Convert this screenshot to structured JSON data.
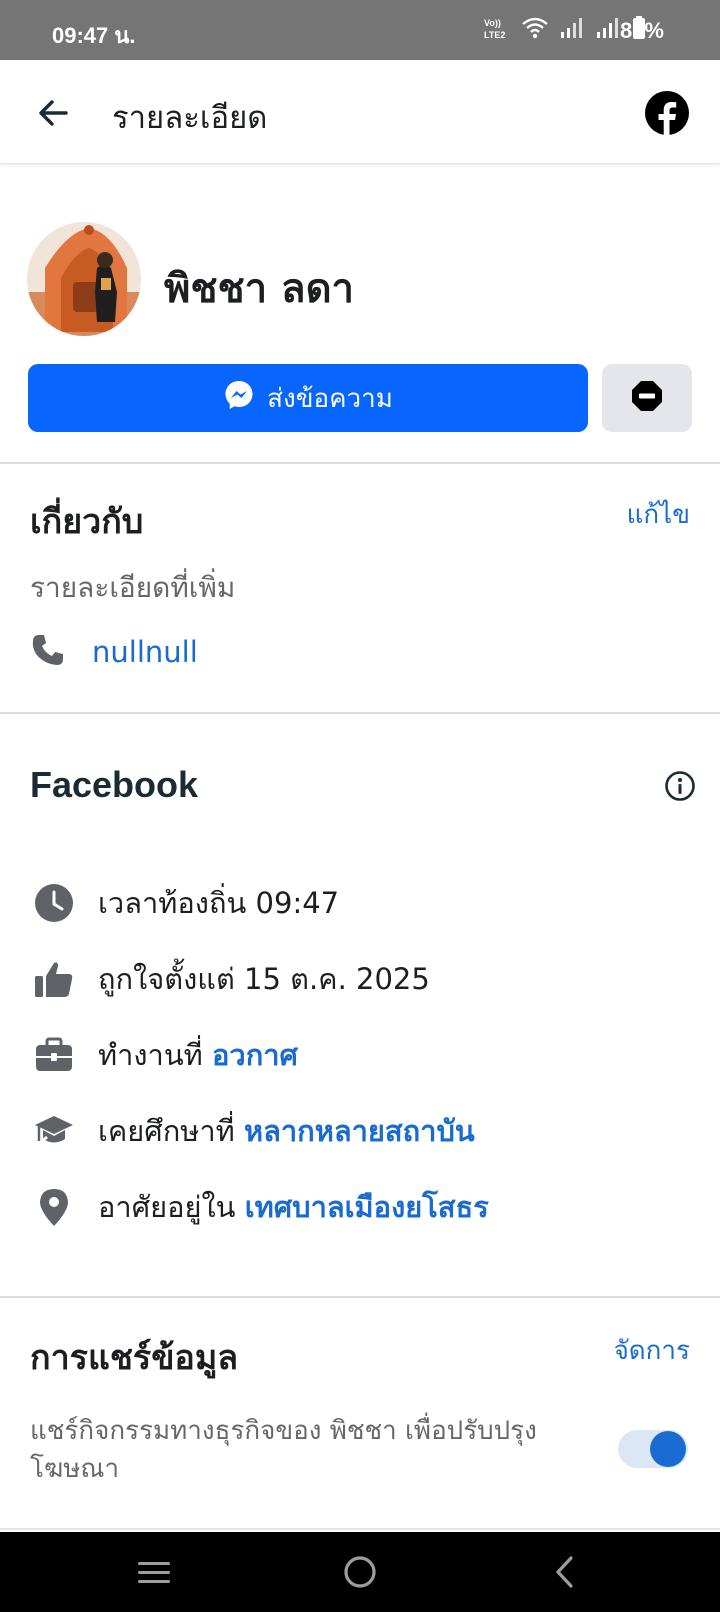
{
  "status_bar": {
    "time": "09:47 น.",
    "network_label": "Vo)) LTE2",
    "battery": "85%"
  },
  "app_bar": {
    "title": "รายละเอียด",
    "back_icon": "arrow-left-icon",
    "brand_icon": "facebook-logo-icon"
  },
  "profile": {
    "name": "พิชชา ลดา",
    "message_button": "ส่งข้อความ",
    "block_icon": "block-icon"
  },
  "about": {
    "title": "เกี่ยวกับ",
    "edit_link": "แก้ไข",
    "subtitle": "รายละเอียดที่เพิ่ม",
    "phone": "nullnull"
  },
  "facebook_section": {
    "title": "Facebook",
    "rows": [
      {
        "icon": "clock-icon",
        "label": "เวลาท้องถิ่น 09:47",
        "link": ""
      },
      {
        "icon": "thumbs-up-icon",
        "label": "ถูกใจตั้งแต่ 15 ต.ค. 2025",
        "link": ""
      },
      {
        "icon": "briefcase-icon",
        "label": "ทำงานที่ ",
        "link": "อวกาศ"
      },
      {
        "icon": "graduation-cap-icon",
        "label": "เคยศึกษาที่ ",
        "link": "หลากหลายสถาบัน"
      },
      {
        "icon": "location-pin-icon",
        "label": "อาศัยอยู่ใน ",
        "link": "เทศบาลเมืองยโสธร"
      }
    ]
  },
  "data_sharing": {
    "title": "การแชร์ข้อมูล",
    "manage_link": "จัดการ",
    "description": "แชร์กิจกรรมทางธุรกิจของ พิชชา เพื่อปรับปรุงโฆษณา",
    "toggle_on": true
  },
  "colors": {
    "brand_blue": "#0866ff",
    "link_blue": "#1a6bd1",
    "status_bar": "#757575"
  }
}
